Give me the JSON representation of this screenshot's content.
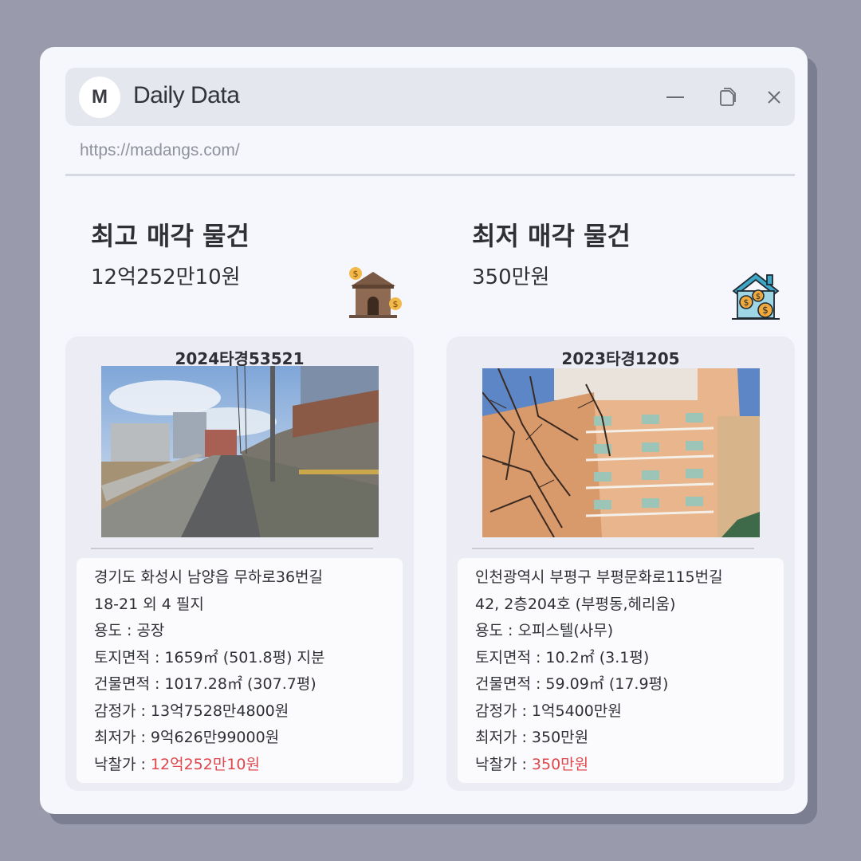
{
  "app": {
    "logo_letter": "M",
    "title": "Daily Data",
    "url": "https://madangs.com/"
  },
  "columns": [
    {
      "heading": "최고 매각 물건",
      "price": "12억252만10원",
      "icon": "house-money-icon"
    },
    {
      "heading": "최저 매각 물건",
      "price": "350만원",
      "icon": "house-coins-icon"
    }
  ],
  "cards": [
    {
      "case_no": "2024타경53521",
      "photo": "factory-street-photo",
      "address_line1": "경기도 화성시 남양읍 무하로36번길",
      "address_line2": "18-21 외 4 필지",
      "usage": "용도 : 공장",
      "land_area": "토지면적 : 1659㎡ (501.8평) 지분",
      "building_area": "건물면적 : 1017.28㎡ (307.7평)",
      "appraisal": "감정가 : 13억7528만4800원",
      "minimum": "최저가 : 9억626만99000원",
      "winning_label": "낙찰가 : ",
      "winning_value": "12억252만10원"
    },
    {
      "case_no": "2023타경1205",
      "photo": "apartment-building-photo",
      "address_line1": "인천광역시 부평구 부평문화로115번길",
      "address_line2": "42, 2층204호 (부평동,헤리움)",
      "usage": "용도 :  오피스텔(사무)",
      "land_area": "토지면적 : 10.2㎡ (3.1평)",
      "building_area": "건물면적 : 59.09㎡ (17.9평)",
      "appraisal": "감정가 : 1억5400만원",
      "minimum": "최저가 : 350만원",
      "winning_label": "낙찰가 : ",
      "winning_value": "350만원"
    }
  ],
  "colors": {
    "background": "#999aab",
    "window": "#f6f7fc",
    "titlebar": "#e5e7ef",
    "card": "#ebecf4",
    "highlight_price": "#e0474c"
  }
}
